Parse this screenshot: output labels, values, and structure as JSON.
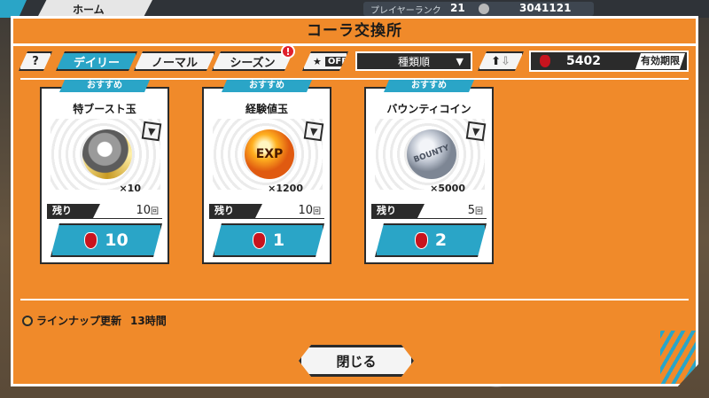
{
  "background": {
    "home_tab": "ホーム",
    "player_rank_label": "プレイヤーランク",
    "player_rank_value": "21",
    "coins": "3041121"
  },
  "dialog": {
    "title": "コーラ交換所"
  },
  "toolbar": {
    "help_label": "?",
    "tabs": [
      {
        "label": "デイリー",
        "active": true
      },
      {
        "label": "ノーマル",
        "active": false
      },
      {
        "label": "シーズン",
        "active": false
      }
    ],
    "season_badge": "!",
    "fav_toggle_label": "OFF",
    "sort_label": "種類順",
    "currency_value": "5402",
    "expiry_label": "有効期限"
  },
  "cards": [
    {
      "tag": "おすすめ",
      "name": "特ブースト玉",
      "qty": "×10",
      "remain_label": "残り",
      "remain_count": "10",
      "remain_unit": "回",
      "price": "10"
    },
    {
      "tag": "おすすめ",
      "name": "経験値玉",
      "qty": "×1200",
      "remain_label": "残り",
      "remain_count": "10",
      "remain_unit": "回",
      "price": "1"
    },
    {
      "tag": "おすすめ",
      "name": "バウンティコイン",
      "qty": "×5000",
      "remain_label": "残り",
      "remain_count": "5",
      "remain_unit": "回",
      "price": "2"
    }
  ],
  "item_art": {
    "exp_text": "EXP",
    "bounty_text": "BOUNTY"
  },
  "lineup": {
    "label": "ラインナップ更新",
    "time": "13時間"
  },
  "close_label": "閉じる",
  "colors": {
    "accent_orange": "#f08a2a",
    "accent_blue": "#2aa5c7",
    "dark": "#2b2b2b"
  }
}
